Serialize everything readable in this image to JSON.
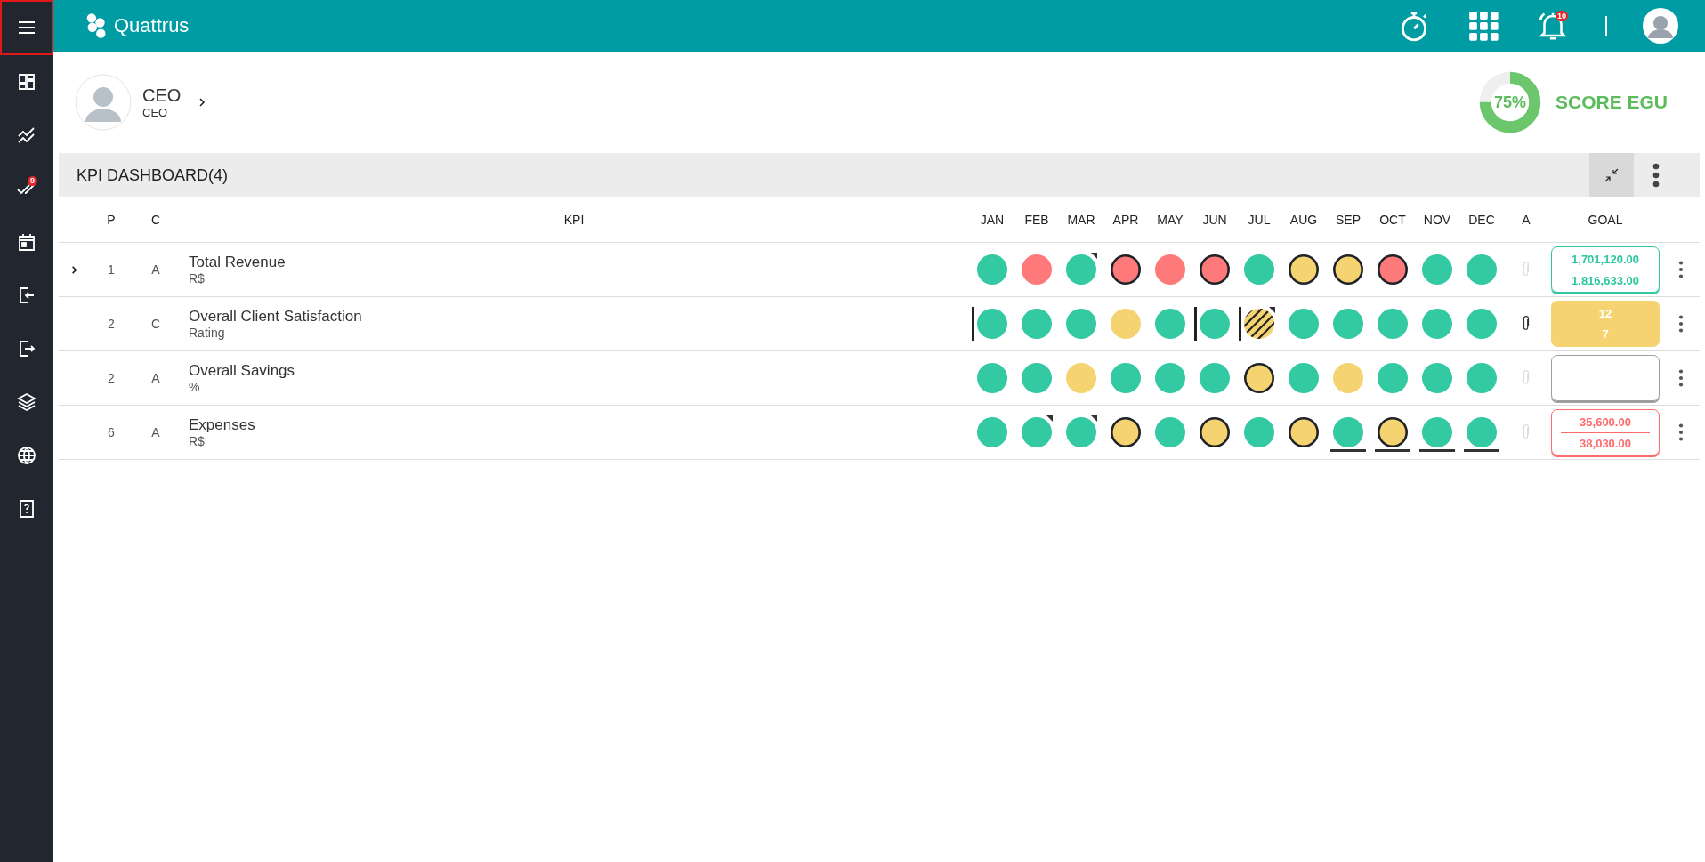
{
  "sidebar": {
    "items": [
      {
        "kind": "menu",
        "selected": true
      },
      {
        "kind": "dashboard",
        "selected": false
      },
      {
        "kind": "trend",
        "selected": false
      },
      {
        "kind": "check",
        "selected": false,
        "badge": "9"
      },
      {
        "kind": "calendar",
        "selected": false
      },
      {
        "kind": "login",
        "selected": false
      },
      {
        "kind": "logout",
        "selected": false
      },
      {
        "kind": "layers",
        "selected": false
      },
      {
        "kind": "globe",
        "selected": false
      },
      {
        "kind": "help",
        "selected": false
      }
    ]
  },
  "topbar": {
    "logo": "Quattrus",
    "notification_count": "10"
  },
  "profile": {
    "name": "CEO",
    "role": "CEO"
  },
  "score": {
    "value": "75%",
    "level": 0.75,
    "label": "SCORE EGU"
  },
  "panel": {
    "title": "KPI DASHBOARD(4)"
  },
  "table": {
    "columns": [
      "P",
      "C",
      "KPI",
      "JAN",
      "FEB",
      "MAR",
      "APR",
      "MAY",
      "JUN",
      "JUL",
      "AUG",
      "SEP",
      "OCT",
      "NOV",
      "DEC",
      "A",
      "GOAL"
    ],
    "rows": [
      {
        "expandable": true,
        "p": "1",
        "c": "A",
        "name": "Total Revenue",
        "unit": "R$",
        "attachment": false,
        "goal": {
          "kind": "outline",
          "color": "#2ec79f",
          "target": "1,701,120.00",
          "actual": "1,816,633.00"
        },
        "months": [
          {
            "kind": "solid",
            "color": "#33c9a3",
            "outlined": false,
            "flagged": false,
            "marker": false,
            "underlined": false
          },
          {
            "kind": "solid",
            "color": "#fe7a7a",
            "outlined": false,
            "flagged": false,
            "marker": false,
            "underlined": false
          },
          {
            "kind": "solid",
            "color": "#33c9a3",
            "outlined": false,
            "flagged": true,
            "marker": false,
            "underlined": false
          },
          {
            "kind": "solid",
            "color": "#fe7a7a",
            "outlined": true,
            "flagged": false,
            "marker": false,
            "underlined": false
          },
          {
            "kind": "solid",
            "color": "#fe7a7a",
            "outlined": false,
            "flagged": false,
            "marker": false,
            "underlined": false
          },
          {
            "kind": "solid",
            "color": "#fe7a7a",
            "outlined": true,
            "flagged": false,
            "marker": false,
            "underlined": false
          },
          {
            "kind": "solid",
            "color": "#33c9a3",
            "outlined": false,
            "flagged": false,
            "marker": false,
            "underlined": false
          },
          {
            "kind": "solid",
            "color": "#f5d370",
            "outlined": true,
            "flagged": false,
            "marker": false,
            "underlined": false
          },
          {
            "kind": "solid",
            "color": "#f5d370",
            "outlined": true,
            "flagged": false,
            "marker": false,
            "underlined": false
          },
          {
            "kind": "solid",
            "color": "#fe7a7a",
            "outlined": true,
            "flagged": false,
            "marker": false,
            "underlined": false
          },
          {
            "kind": "solid",
            "color": "#33c9a3",
            "outlined": false,
            "flagged": false,
            "marker": false,
            "underlined": false
          },
          {
            "kind": "solid",
            "color": "#33c9a3",
            "outlined": false,
            "flagged": false,
            "marker": false,
            "underlined": false
          }
        ]
      },
      {
        "expandable": false,
        "p": "2",
        "c": "C",
        "name": "Overall Client Satisfaction",
        "unit": "Rating",
        "attachment": true,
        "goal": {
          "kind": "filled",
          "color": "#f5d370",
          "target": "12",
          "actual": "7"
        },
        "months": [
          {
            "kind": "solid",
            "color": "#33c9a3",
            "outlined": false,
            "flagged": false,
            "marker": true,
            "underlined": false
          },
          {
            "kind": "solid",
            "color": "#33c9a3",
            "outlined": false,
            "flagged": false,
            "marker": false,
            "underlined": false
          },
          {
            "kind": "solid",
            "color": "#33c9a3",
            "outlined": false,
            "flagged": false,
            "marker": false,
            "underlined": false
          },
          {
            "kind": "solid",
            "color": "#f5d370",
            "outlined": false,
            "flagged": false,
            "marker": false,
            "underlined": false
          },
          {
            "kind": "solid",
            "color": "#33c9a3",
            "outlined": false,
            "flagged": false,
            "marker": false,
            "underlined": false
          },
          {
            "kind": "solid",
            "color": "#33c9a3",
            "outlined": false,
            "flagged": false,
            "marker": true,
            "underlined": false
          },
          {
            "kind": "striped",
            "color": "#f5d370",
            "outlined": false,
            "flagged": true,
            "marker": true,
            "underlined": false
          },
          {
            "kind": "solid",
            "color": "#33c9a3",
            "outlined": false,
            "flagged": false,
            "marker": false,
            "underlined": false
          },
          {
            "kind": "solid",
            "color": "#33c9a3",
            "outlined": false,
            "flagged": false,
            "marker": false,
            "underlined": false
          },
          {
            "kind": "solid",
            "color": "#33c9a3",
            "outlined": false,
            "flagged": false,
            "marker": false,
            "underlined": false
          },
          {
            "kind": "solid",
            "color": "#33c9a3",
            "outlined": false,
            "flagged": false,
            "marker": false,
            "underlined": false
          },
          {
            "kind": "solid",
            "color": "#33c9a3",
            "outlined": false,
            "flagged": false,
            "marker": false,
            "underlined": false
          }
        ]
      },
      {
        "expandable": false,
        "p": "2",
        "c": "A",
        "name": "Overall Savings",
        "unit": "%",
        "attachment": false,
        "goal": {
          "kind": "outline",
          "color": "#9e9e9e"
        },
        "months": [
          {
            "kind": "solid",
            "color": "#33c9a3",
            "outlined": false,
            "flagged": false,
            "marker": false,
            "underlined": false
          },
          {
            "kind": "solid",
            "color": "#33c9a3",
            "outlined": false,
            "flagged": false,
            "marker": false,
            "underlined": false
          },
          {
            "kind": "solid",
            "color": "#f5d370",
            "outlined": false,
            "flagged": false,
            "marker": false,
            "underlined": false
          },
          {
            "kind": "solid",
            "color": "#33c9a3",
            "outlined": false,
            "flagged": false,
            "marker": false,
            "underlined": false
          },
          {
            "kind": "solid",
            "color": "#33c9a3",
            "outlined": false,
            "flagged": false,
            "marker": false,
            "underlined": false
          },
          {
            "kind": "solid",
            "color": "#33c9a3",
            "outlined": false,
            "flagged": false,
            "marker": false,
            "underlined": false
          },
          {
            "kind": "solid",
            "color": "#f5d370",
            "outlined": true,
            "flagged": false,
            "marker": false,
            "underlined": false
          },
          {
            "kind": "solid",
            "color": "#33c9a3",
            "outlined": false,
            "flagged": false,
            "marker": false,
            "underlined": false
          },
          {
            "kind": "solid",
            "color": "#f5d370",
            "outlined": false,
            "flagged": false,
            "marker": false,
            "underlined": false
          },
          {
            "kind": "solid",
            "color": "#33c9a3",
            "outlined": false,
            "flagged": false,
            "marker": false,
            "underlined": false
          },
          {
            "kind": "solid",
            "color": "#33c9a3",
            "outlined": false,
            "flagged": false,
            "marker": false,
            "underlined": false
          },
          {
            "kind": "solid",
            "color": "#33c9a3",
            "outlined": false,
            "flagged": false,
            "marker": false,
            "underlined": false
          }
        ]
      },
      {
        "expandable": false,
        "p": "6",
        "c": "A",
        "name": "Expenses",
        "unit": "R$",
        "attachment": false,
        "goal": {
          "kind": "outline",
          "color": "#fe6b6b",
          "target": "35,600.00",
          "actual": "38,030.00"
        },
        "months": [
          {
            "kind": "solid",
            "color": "#33c9a3",
            "outlined": false,
            "flagged": false,
            "marker": false,
            "underlined": false
          },
          {
            "kind": "solid",
            "color": "#33c9a3",
            "outlined": false,
            "flagged": true,
            "marker": false,
            "underlined": false
          },
          {
            "kind": "solid",
            "color": "#33c9a3",
            "outlined": false,
            "flagged": true,
            "marker": false,
            "underlined": false
          },
          {
            "kind": "solid",
            "color": "#f5d370",
            "outlined": true,
            "flagged": false,
            "marker": false,
            "underlined": false
          },
          {
            "kind": "solid",
            "color": "#33c9a3",
            "outlined": false,
            "flagged": false,
            "marker": false,
            "underlined": false
          },
          {
            "kind": "solid",
            "color": "#f5d370",
            "outlined": true,
            "flagged": false,
            "marker": false,
            "underlined": false
          },
          {
            "kind": "solid",
            "color": "#33c9a3",
            "outlined": false,
            "flagged": false,
            "marker": false,
            "underlined": false
          },
          {
            "kind": "solid",
            "color": "#f5d370",
            "outlined": true,
            "flagged": false,
            "marker": false,
            "underlined": false
          },
          {
            "kind": "solid",
            "color": "#33c9a3",
            "outlined": false,
            "flagged": false,
            "marker": false,
            "underlined": true
          },
          {
            "kind": "solid",
            "color": "#f5d370",
            "outlined": true,
            "flagged": false,
            "marker": false,
            "underlined": true
          },
          {
            "kind": "solid",
            "color": "#33c9a3",
            "outlined": false,
            "flagged": false,
            "marker": false,
            "underlined": true
          },
          {
            "kind": "solid",
            "color": "#33c9a3",
            "outlined": false,
            "flagged": false,
            "marker": false,
            "underlined": true
          }
        ]
      }
    ]
  }
}
